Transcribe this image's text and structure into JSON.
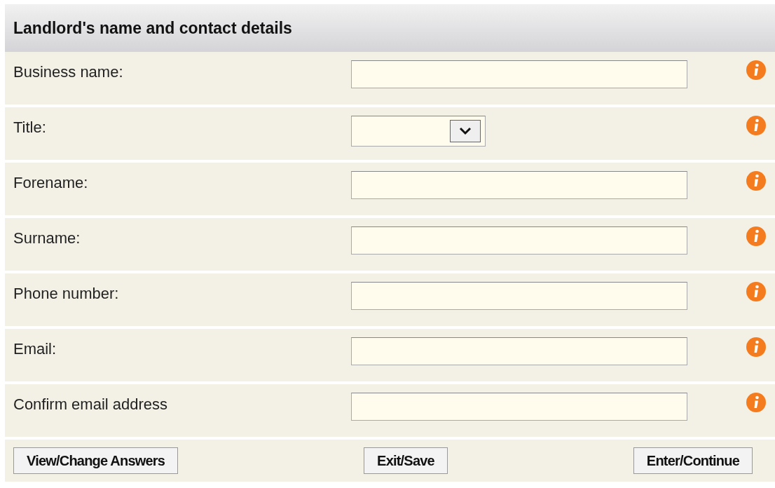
{
  "section": {
    "title": "Landlord's name and contact details"
  },
  "fields": [
    {
      "label": "Business name:",
      "kind": "text"
    },
    {
      "label": "Title:",
      "kind": "select"
    },
    {
      "label": "Forename:",
      "kind": "text"
    },
    {
      "label": "Surname:",
      "kind": "text"
    },
    {
      "label": "Phone number:",
      "kind": "text"
    },
    {
      "label": "Email:",
      "kind": "text"
    },
    {
      "label": "Confirm email address",
      "kind": "text"
    }
  ],
  "buttons": [
    "View/Change Answers",
    "Exit/Save",
    "Enter/Continue"
  ]
}
